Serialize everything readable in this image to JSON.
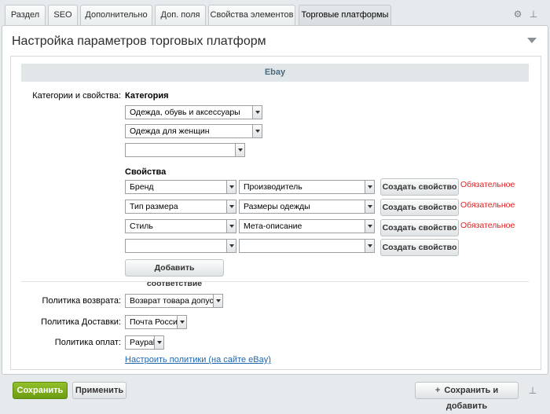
{
  "tabs": [
    {
      "label": "Раздел"
    },
    {
      "label": "SEO"
    },
    {
      "label": "Дополнительно"
    },
    {
      "label": "Доп. поля"
    },
    {
      "label": "Свойства элементов"
    },
    {
      "label": "Торговые платформы",
      "active": true
    }
  ],
  "toolbar_icons": [
    "gear-icon",
    "pin-icon"
  ],
  "panel": {
    "title": "Настройка параметров торговых платформ",
    "section_title": "Ebay"
  },
  "categories": {
    "label": "Категории и свойства:",
    "heading": "Категория",
    "selects": [
      "Одежда, обувь и аксессуары",
      "Одежда для женщин",
      ""
    ]
  },
  "properties": {
    "heading": "Свойства",
    "rows": [
      {
        "ebay": "Бренд",
        "local": "Производитель",
        "button": "Создать свойство",
        "required": "Обязательное"
      },
      {
        "ebay": "Тип размера",
        "local": "Размеры одежды",
        "button": "Создать свойство",
        "required": "Обязательное"
      },
      {
        "ebay": "Стиль",
        "local": "Мета-описание",
        "button": "Создать свойство",
        "required": "Обязательное"
      },
      {
        "ebay": "",
        "local": "",
        "button": "Создать свойство",
        "required": ""
      }
    ],
    "add_button": "Добавить соответствие"
  },
  "policies": {
    "return_label": "Политика возврата:",
    "return_value": "Возврат товара допустим",
    "delivery_label": "Политика Доставки:",
    "delivery_value": "Почта России",
    "payment_label": "Политика оплат:",
    "payment_value": "Paypal",
    "link": "Настроить политики (на сайте eBay)"
  },
  "footer": {
    "save": "Сохранить",
    "apply": "Применить",
    "save_add": "Сохранить и добавить"
  },
  "colors": {
    "save_button": "#7aaa17",
    "required_text": "#e02020",
    "link": "#2067b0",
    "section_header": "#e1e6e8"
  }
}
